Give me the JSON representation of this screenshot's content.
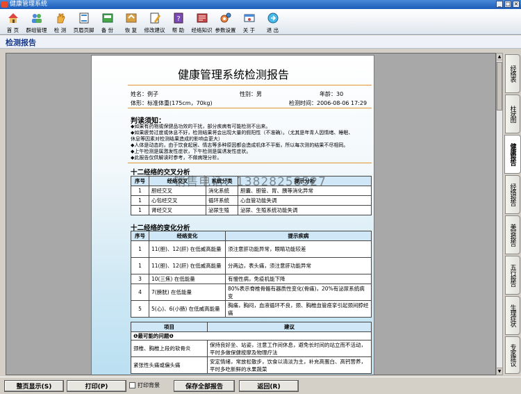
{
  "window": {
    "title": "健康管理系统"
  },
  "toolbar": [
    {
      "label": "首 页",
      "icon": "home-icon"
    },
    {
      "label": "群组管理",
      "icon": "group-icon"
    },
    {
      "label": "检 测",
      "icon": "hand-icon"
    },
    {
      "label": "页眉页脚",
      "icon": "page-icon"
    },
    {
      "label": "备 份",
      "icon": "backup-icon"
    },
    {
      "label": "恢 复",
      "icon": "restore-icon"
    },
    {
      "label": "修改建议",
      "icon": "edit-icon"
    },
    {
      "label": "帮 助",
      "icon": "help-icon"
    },
    {
      "label": "经络知识",
      "icon": "book-icon"
    },
    {
      "label": "参数设置",
      "icon": "gear-icon"
    },
    {
      "label": "关 于",
      "icon": "about-icon"
    },
    {
      "label": "退 出",
      "icon": "exit-icon"
    }
  ],
  "header": {
    "title": "检测报告"
  },
  "report": {
    "title": "健康管理系统检测报告",
    "name_label": "姓名：",
    "name": "例子",
    "gender_label": "性别：",
    "gender": "男",
    "age_label": "年龄：",
    "age": "30",
    "body_label": "体形：",
    "body": "标准体重(175cm，70kg)",
    "time_label": "检测时间：",
    "time": "2006-08-06 17:29",
    "notice_title": "判读须知：",
    "notice": [
      "◆如果有药物或保健品功效的干扰，部分疾病有可能检测不出来。",
      "◆如果疲劳过度或休息不好，检测结果将会出现大量的假阳性（不准确）。（尤其是年青人因情绪、睡眠、",
      "休息等因素对检测结果造成的影响会更大）",
      "◆人体是动态的，由于饮食起居、情志等多种原因都会造成机体不平衡，所以每次测的结果不尽相同。",
      "◆上午检测是属激发性症状，下午检测是属诱发性症状。",
      "◆此报告仅供解读时参考，不做病理分析。"
    ],
    "cross_title": "十二经络的交叉分析",
    "cross_headers": [
      "序号",
      "经络交叉",
      "系统分类",
      "提示分析"
    ],
    "cross_rows": [
      [
        "1",
        "胆经交叉",
        "消化系统",
        "胆囊、胆管、胃、胰等消化异常"
      ],
      [
        "1",
        "心包经交叉",
        "循环系统",
        "心血管功能失调"
      ],
      [
        "1",
        "肾经交叉",
        "泌尿生殖",
        "泌尿、生殖系统功能失调"
      ]
    ],
    "change_title": "十二经络的变化分析",
    "change_headers": [
      "序号",
      "经络变化",
      "提示疾病"
    ],
    "change_rows": [
      [
        "1",
        "11(胆)、12(肝) 在低威高能量",
        "须注意肝功能异常，眼睛功能较差"
      ],
      [
        "1",
        "11(胆)、12(肝) 在低威高能量",
        "分两边，表头痛，须注意肝功能异常"
      ],
      [
        "3",
        "10(三焦) 在低能量",
        "有慢性病，免疫机能下降"
      ],
      [
        "4",
        "7(膀胱) 在低能量",
        "80%表示脊椎骨骼有器质性变化(骨痛)，20%有泌尿系统病变"
      ],
      [
        "5",
        "5(心)、6(小肠) 在低威高能量",
        "胸痛，胸闷，血液循环不良，颈、胸椎血管痉挛引起颈间脖经痛"
      ]
    ],
    "advice_headers": [
      "项目",
      "建议"
    ],
    "advice_section": "❶最可能的问题❶",
    "advice_rows": [
      [
        "颈椎、胸椎上段的软骨炎",
        "保持良好坐、站姿，注意工作间休息，避免长时间的站立而不活动，平时多做保健按摩及物理疗法"
      ],
      [
        "紧张性头痛或偏头痛",
        "安定情绪，常放松散步，饮食以清淡为主，补充高蛋白、高钙营养，平时多吃新鲜的水果蔬菜"
      ]
    ]
  },
  "watermark": "销售电话：13828258527",
  "side_tabs": [
    "经络表",
    "柱状图",
    "健康报告",
    "经络报告",
    "美容报告",
    "五行报告",
    "生理症状",
    "专家建议"
  ],
  "active_tab": "健康报告",
  "buttons": {
    "fullpage": "整页显示(S)",
    "print": "打印(P)",
    "print_bg": "打印背景",
    "save_all": "保存全部报告",
    "back": "返回(R)"
  }
}
